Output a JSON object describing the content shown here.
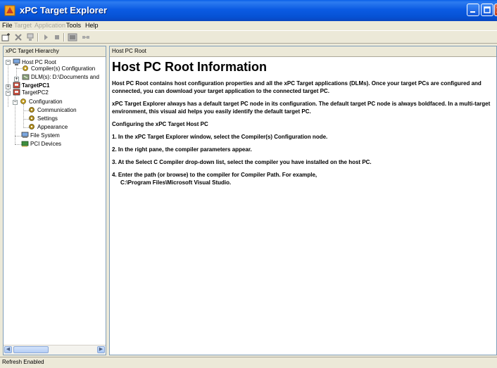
{
  "window": {
    "title": "xPC Target Explorer"
  },
  "menu": {
    "items": [
      {
        "label": "File",
        "enabled": true
      },
      {
        "label": "Target",
        "enabled": false
      },
      {
        "label": "Application",
        "enabled": false
      },
      {
        "label": "Tools",
        "enabled": true
      },
      {
        "label": "Help",
        "enabled": true
      }
    ]
  },
  "toolbar": {
    "icons": [
      "add-target-icon",
      "delete-icon",
      "connect-icon",
      "start-icon",
      "stop-icon",
      "scope-icon",
      "disconnect-icon"
    ]
  },
  "left_pane": {
    "header": "xPC Target Hierarchy",
    "tree": [
      {
        "label": "Host PC Root",
        "icon": "host-pc-icon",
        "bold": false,
        "selected": true
      },
      {
        "label": "Compiler(s) Configuration",
        "icon": "config-gear-icon",
        "bold": false
      },
      {
        "label": "DLM(s): D:\\Documents and",
        "icon": "dlm-folder-icon",
        "bold": false
      },
      {
        "label": "TargetPC1",
        "icon": "target-pc-icon",
        "bold": true
      },
      {
        "label": "TargetPC2",
        "icon": "target-pc-icon",
        "bold": false
      },
      {
        "label": "Configuration",
        "icon": "config-gear-icon",
        "bold": false
      },
      {
        "label": "Communication",
        "icon": "gear-icon",
        "bold": false
      },
      {
        "label": "Settings",
        "icon": "gear-icon",
        "bold": false
      },
      {
        "label": "Appearance",
        "icon": "gear-icon",
        "bold": false
      },
      {
        "label": "File System",
        "icon": "file-system-icon",
        "bold": false
      },
      {
        "label": "PCI Devices",
        "icon": "pci-devices-icon",
        "bold": false
      }
    ]
  },
  "right_pane": {
    "header": "Host PC Root",
    "heading": "Host PC Root Information",
    "paragraphs": [
      "Host PC Root contains host configuration properties and all the xPC Target applications (DLMs). Once your target PCs are configured and connected, you can download your target application to the connected target PC.",
      "xPC Target Explorer always has a default target PC node in its configuration. The default target PC node is always boldfaced. In a multi-target environment, this visual aid helps you easily identify the default target PC.",
      "Configuring the xPC Target Host PC",
      "1. In the xPC Target Explorer window, select the Compiler(s) Configuration node.",
      "2. In the right pane, the compiler parameters appear.",
      "3. At the Select C Compiler drop-down list, select the compiler you have installed on the host PC.",
      "4. Enter the path (or browse) to the compiler for Compiler Path. For example,",
      "C:\\Program Files\\Microsoft Visual Studio."
    ]
  },
  "status": {
    "text": "Refresh Enabled"
  },
  "colors": {
    "titlebar": "#0a5fe8",
    "pane_border": "#7f9db9",
    "chrome": "#ece9d8"
  }
}
